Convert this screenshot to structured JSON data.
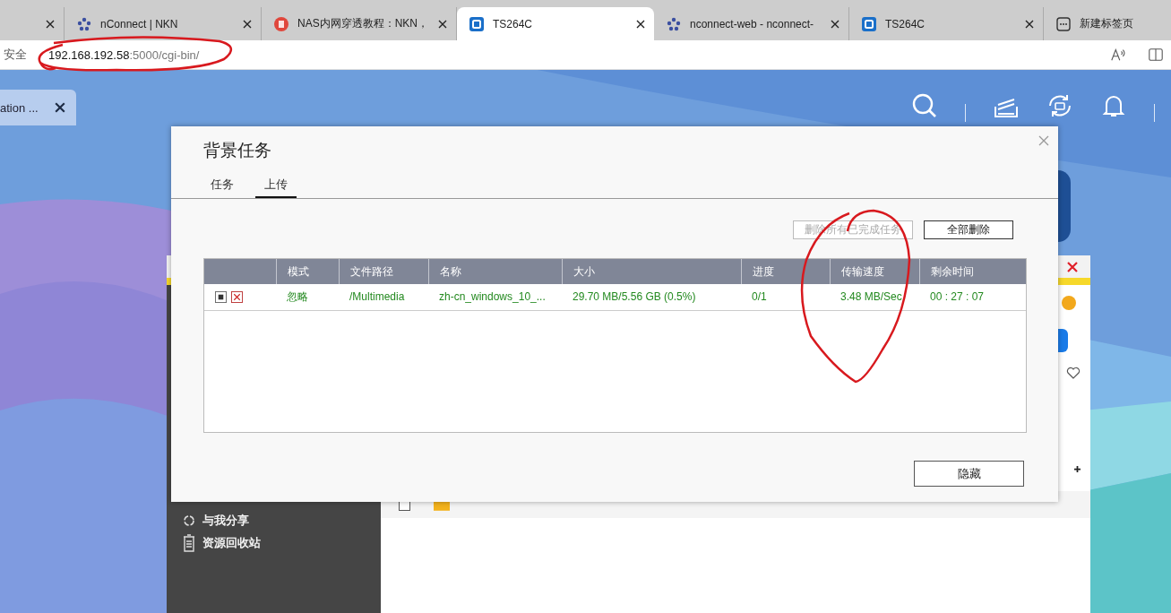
{
  "browser": {
    "tabs": [
      {
        "kind": "none",
        "selected": false
      },
      {
        "kind": "flower",
        "title": "nConnect | NKN",
        "selected": false
      },
      {
        "kind": "red",
        "title": "NAS内网穿透教程：NKN，",
        "selected": false
      },
      {
        "kind": "qnap",
        "title": "TS264C",
        "selected": true
      },
      {
        "kind": "flower",
        "title": "nconnect-web - nconnect-",
        "selected": false
      },
      {
        "kind": "qnap",
        "title": "TS264C",
        "selected": false
      }
    ],
    "new_tab": {
      "title": "新建标签页"
    },
    "address_bar": {
      "security": "安全",
      "host": "192.168.192.58",
      "path": ":5000/cgi-bin/"
    }
  },
  "desktop": {
    "taskbar_tab": {
      "title": "ation ..."
    }
  },
  "file_station": {
    "row": {
      "checked": false
    },
    "sidebar": [
      {
        "kind": "share",
        "label": "与我分享"
      },
      {
        "kind": "trash",
        "label": "资源回收站"
      }
    ]
  },
  "dialog": {
    "title": "背景任务",
    "tabs": [
      {
        "label": "任务",
        "selected": false
      },
      {
        "label": "上传",
        "selected": true
      }
    ],
    "buttons": [
      {
        "label": "删除所有已完成任务",
        "disabled": true
      },
      {
        "label": "全部删除",
        "disabled": false
      }
    ],
    "table": {
      "columns": [
        "模式",
        "文件路径",
        "名称",
        "大小",
        "进度",
        "传输速度",
        "剩余时间"
      ],
      "rows": [
        {
          "cells": [
            "忽略",
            "/Multimedia",
            "zh-cn_windows_10_...",
            "29.70 MB/5.56 GB (0.5%)",
            "0/1",
            "3.48 MB/Sec",
            "00 : 27 : 07"
          ]
        }
      ]
    },
    "hide_button": "隐藏"
  }
}
